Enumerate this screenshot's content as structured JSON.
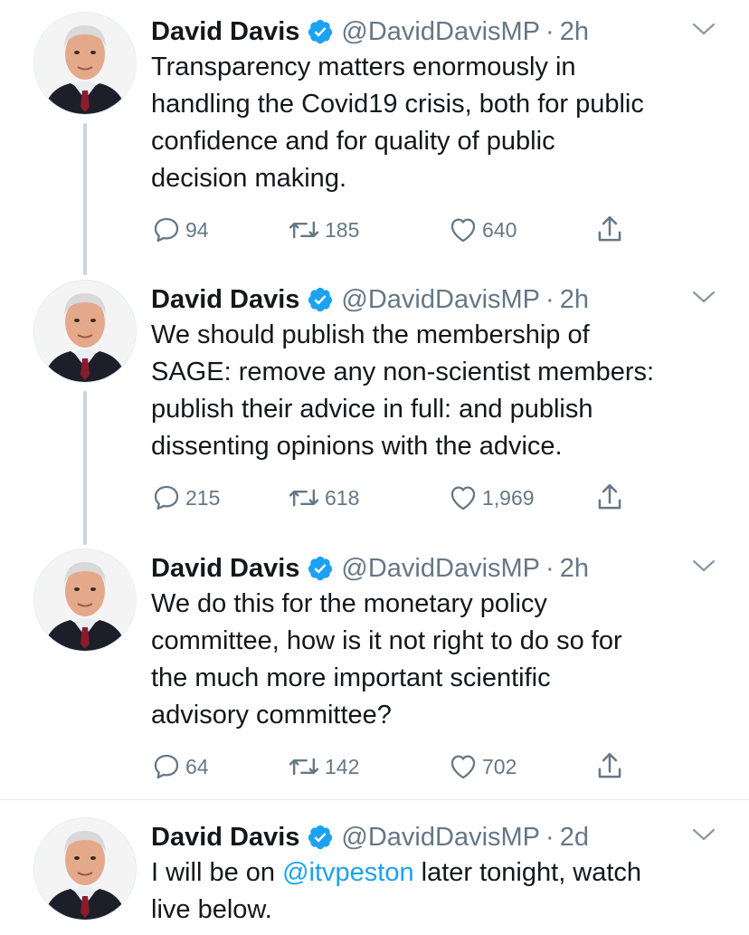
{
  "colors": {
    "link": "#1da1f2",
    "secondary_text": "#657786",
    "primary_text": "#14171a",
    "thread_line": "#ccd6dd",
    "verified_badge": "#1da1f2"
  },
  "icons": {
    "reply": "reply-icon",
    "retweet": "retweet-icon",
    "like": "heart-icon",
    "share": "share-icon",
    "verified": "verified-badge-icon",
    "more": "chevron-down-icon"
  },
  "tweets": [
    {
      "name": "David Davis",
      "handle": "@DavidDavisMP",
      "separator": "·",
      "time": "2h",
      "text": "Transparency matters enormously in\nhandling the Covid19 crisis, both for public\nconfidence and for quality of public\ndecision making.",
      "replies": "94",
      "retweets": "185",
      "likes": "640"
    },
    {
      "name": "David Davis",
      "handle": "@DavidDavisMP",
      "separator": "·",
      "time": "2h",
      "text": "We should publish the membership of\nSAGE: remove any non-scientist members:\npublish their advice in full: and publish\ndissenting opinions with the advice.",
      "replies": "215",
      "retweets": "618",
      "likes": "1,969"
    },
    {
      "name": "David Davis",
      "handle": "@DavidDavisMP",
      "separator": "·",
      "time": "2h",
      "text": "We do this for the monetary policy\ncommittee, how is it not right to do so for\nthe much more important scientific\nadvisory committee?",
      "replies": "64",
      "retweets": "142",
      "likes": "702"
    },
    {
      "name": "David Davis",
      "handle": "@DavidDavisMP",
      "separator": "·",
      "time": "2d",
      "text_before": "I will be on ",
      "mention": "@itvpeston",
      "text_after": " later tonight, watch\nlive below."
    }
  ]
}
